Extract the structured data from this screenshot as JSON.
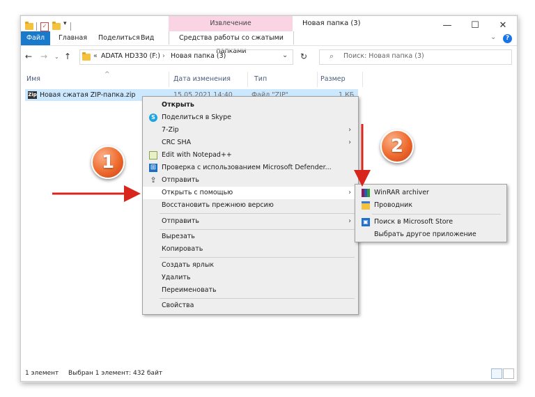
{
  "window": {
    "title": "Новая папка (3)",
    "contextual_group": "Извлечение",
    "controls": {
      "minimize": "—",
      "maximize": "☐",
      "close": "✕"
    }
  },
  "ribbon": {
    "tabs": [
      "Файл",
      "Главная",
      "Поделиться",
      "Вид",
      "Средства работы со сжатыми папками"
    ],
    "help": "?"
  },
  "nav": {
    "breadcrumb_prefix": "«",
    "drive": "ADATA HD330 (F:)",
    "separator": "›",
    "folder": "Новая папка (3)",
    "search_placeholder": "Поиск: Новая папка (3)"
  },
  "columns": [
    "Имя",
    "Дата изменения",
    "Тип",
    "Размер"
  ],
  "files": [
    {
      "name": "Новая сжатая ZIP-папка.zip",
      "date": "15.05.2021 14:40",
      "type": "Файл \"ZIP\"",
      "size": "1 КБ"
    }
  ],
  "context_menu": [
    {
      "label": "Открыть",
      "bold": true
    },
    {
      "label": "Поделиться в Skype",
      "icon": "skype-icon"
    },
    {
      "label": "7-Zip",
      "submenu": true
    },
    {
      "label": "CRC SHA",
      "submenu": true
    },
    {
      "label": "Edit with Notepad++",
      "icon": "notepad-plus-plus-icon"
    },
    {
      "label": "Проверка с использованием Microsoft Defender...",
      "icon": "defender-icon"
    },
    {
      "label": "Отправить",
      "icon": "share-icon"
    },
    {
      "label": "Открыть с помощью",
      "submenu": true,
      "highlighted": true
    },
    {
      "label": "Восстановить прежнюю версию"
    },
    {
      "label": "Отправить",
      "submenu": true
    },
    {
      "label": "Вырезать"
    },
    {
      "label": "Копировать"
    },
    {
      "label": "Создать ярлык"
    },
    {
      "label": "Удалить"
    },
    {
      "label": "Переименовать"
    },
    {
      "label": "Свойства"
    }
  ],
  "open_with_submenu": [
    {
      "label": "WinRAR archiver",
      "icon": "winrar-icon"
    },
    {
      "label": "Проводник",
      "icon": "explorer-icon"
    },
    {
      "label": "Поиск в Microsoft Store",
      "icon": "store-icon"
    },
    {
      "label": "Выбрать другое приложение"
    }
  ],
  "status": {
    "count": "1 элемент",
    "selected": "Выбран 1 элемент: 432 байт"
  },
  "annotations": {
    "step1": "1",
    "step2": "2",
    "color": "#d9261c"
  }
}
